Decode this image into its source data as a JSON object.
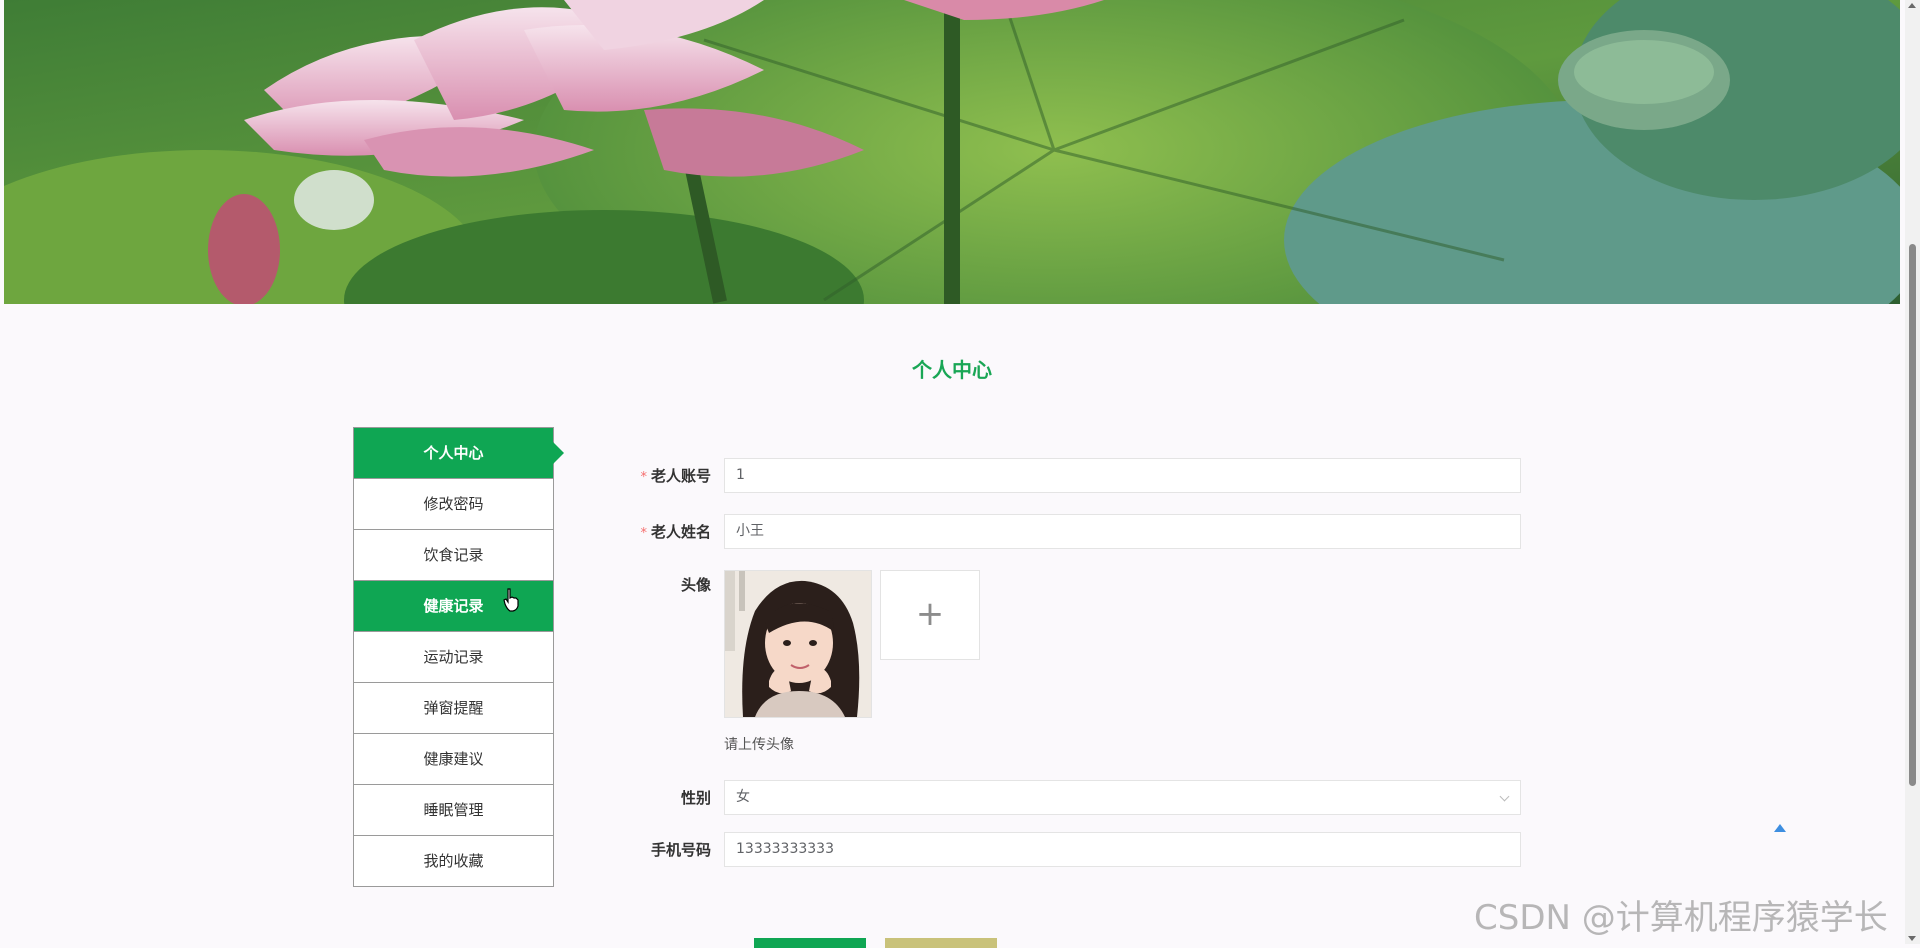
{
  "page": {
    "title": "个人中心"
  },
  "menu": {
    "items": [
      {
        "label": "个人中心",
        "state": "active"
      },
      {
        "label": "修改密码",
        "state": ""
      },
      {
        "label": "饮食记录",
        "state": ""
      },
      {
        "label": "健康记录",
        "state": "hover"
      },
      {
        "label": "运动记录",
        "state": ""
      },
      {
        "label": "弹窗提醒",
        "state": ""
      },
      {
        "label": "健康建议",
        "state": ""
      },
      {
        "label": "睡眠管理",
        "state": ""
      },
      {
        "label": "我的收藏",
        "state": ""
      }
    ]
  },
  "form": {
    "required_mark": "*",
    "account": {
      "label": "老人账号",
      "value": "1"
    },
    "name": {
      "label": "老人姓名",
      "value": "小王"
    },
    "avatar": {
      "label": "头像",
      "hint": "请上传头像",
      "upload_icon": "plus-icon"
    },
    "gender": {
      "label": "性别",
      "value": "女"
    },
    "phone": {
      "label": "手机号码",
      "value": "13333333333"
    }
  },
  "watermark": "CSDN @计算机程序猿学长",
  "colors": {
    "accent": "#0fa653",
    "title": "#19a655",
    "required": "#f56c6c",
    "reset": "#c9c27a",
    "back_top": "#3d8ee0"
  }
}
